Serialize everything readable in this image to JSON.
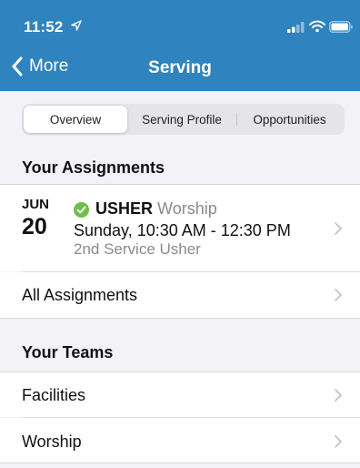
{
  "status_bar": {
    "time": "11:52"
  },
  "nav": {
    "back_label": "More",
    "title": "Serving"
  },
  "segments": [
    "Overview",
    "Serving Profile",
    "Opportunities"
  ],
  "assignments": {
    "section_title": "Your Assignments",
    "item": {
      "month": "JUN",
      "day": "20",
      "role": "USHER",
      "team": "Worship",
      "time": "Sunday, 10:30 AM - 12:30 PM",
      "position": "2nd Service Usher"
    },
    "all_label": "All Assignments"
  },
  "teams": {
    "section_title": "Your Teams",
    "items": [
      "Facilities",
      "Worship"
    ]
  },
  "colors": {
    "header": "#2f83bf",
    "check": "#6cc04a",
    "background": "#f2f2f7"
  }
}
